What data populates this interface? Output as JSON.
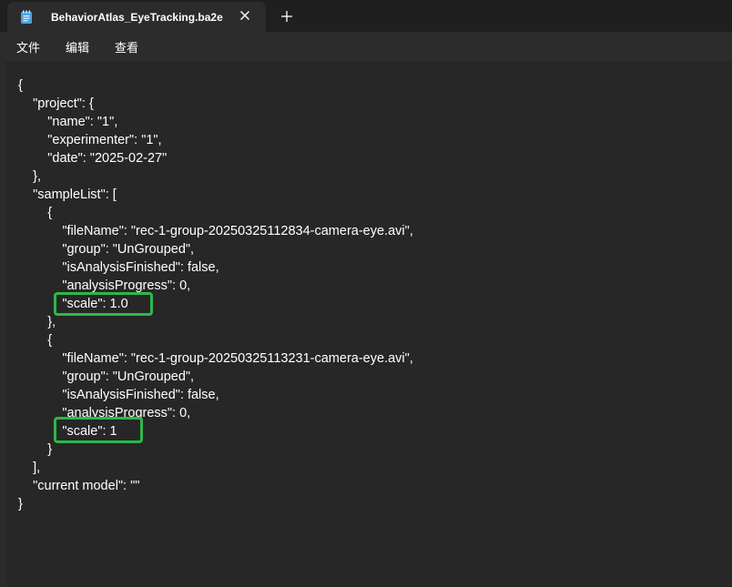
{
  "tab": {
    "title": "BehaviorAtlas_EyeTracking.ba2e",
    "icon": "notepad-icon",
    "close_icon": "close-icon",
    "new_tab_icon": "plus-icon"
  },
  "menu": {
    "file": "文件",
    "edit": "编辑",
    "view": "查看"
  },
  "editor": {
    "lines": [
      "{",
      "    \"project\": {",
      "        \"name\": \"1\",",
      "        \"experimenter\": \"1\",",
      "        \"date\": \"2025-02-27\"",
      "    },",
      "    \"sampleList\": [",
      "        {",
      "            \"fileName\": \"rec-1-group-20250325112834-camera-eye.avi\",",
      "            \"group\": \"UnGrouped\",",
      "            \"isAnalysisFinished\": false,",
      "            \"analysisProgress\": 0,",
      "            \"scale\": 1.0",
      "        },",
      "        {",
      "            \"fileName\": \"rec-1-group-20250325113231-camera-eye.avi\",",
      "            \"group\": \"UnGrouped\",",
      "            \"isAnalysisFinished\": false,",
      "            \"analysisProgress\": 0,",
      "            \"scale\": 1",
      "        }",
      "    ],",
      "    \"current model\": \"\"",
      "}"
    ]
  },
  "colors": {
    "highlight": "#2eb84a",
    "background": "#272727",
    "tabbar": "#1f1f1f",
    "text": "#ffffff"
  }
}
